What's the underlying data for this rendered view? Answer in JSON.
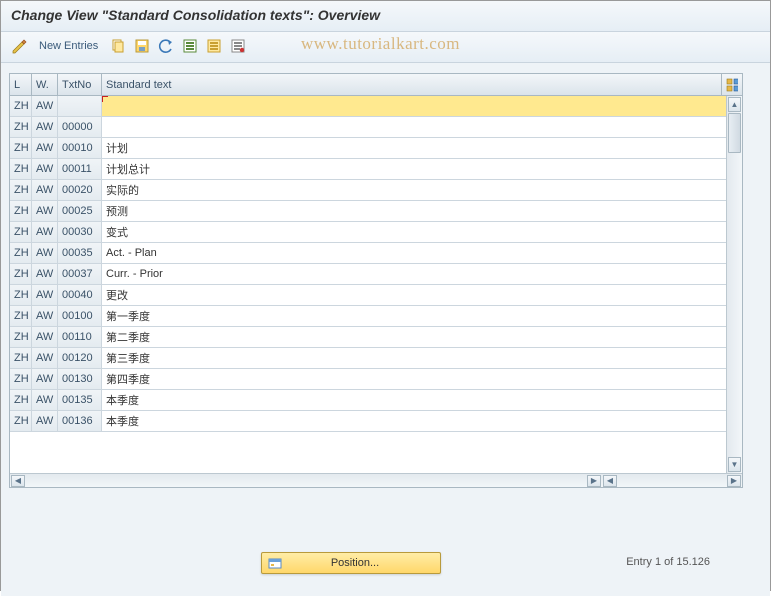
{
  "title": "Change View \"Standard Consolidation texts\": Overview",
  "toolbar": {
    "new_entries": "New Entries"
  },
  "watermark": "www.tutorialkart.com",
  "table": {
    "headers": {
      "l": "L",
      "w": "W.",
      "txtno": "TxtNo",
      "std": "Standard text"
    },
    "rows": [
      {
        "l": "ZH",
        "w": "AW",
        "txtno": "",
        "std": "",
        "active": true
      },
      {
        "l": "ZH",
        "w": "AW",
        "txtno": "00000",
        "std": ""
      },
      {
        "l": "ZH",
        "w": "AW",
        "txtno": "00010",
        "std": "计划"
      },
      {
        "l": "ZH",
        "w": "AW",
        "txtno": "00011",
        "std": "计划总计"
      },
      {
        "l": "ZH",
        "w": "AW",
        "txtno": "00020",
        "std": "实际的"
      },
      {
        "l": "ZH",
        "w": "AW",
        "txtno": "00025",
        "std": "预测"
      },
      {
        "l": "ZH",
        "w": "AW",
        "txtno": "00030",
        "std": "变式"
      },
      {
        "l": "ZH",
        "w": "AW",
        "txtno": "00035",
        "std": "Act. - Plan"
      },
      {
        "l": "ZH",
        "w": "AW",
        "txtno": "00037",
        "std": "Curr. - Prior"
      },
      {
        "l": "ZH",
        "w": "AW",
        "txtno": "00040",
        "std": "更改"
      },
      {
        "l": "ZH",
        "w": "AW",
        "txtno": "00100",
        "std": "第一季度"
      },
      {
        "l": "ZH",
        "w": "AW",
        "txtno": "00110",
        "std": "第二季度"
      },
      {
        "l": "ZH",
        "w": "AW",
        "txtno": "00120",
        "std": "第三季度"
      },
      {
        "l": "ZH",
        "w": "AW",
        "txtno": "00130",
        "std": "第四季度"
      },
      {
        "l": "ZH",
        "w": "AW",
        "txtno": "00135",
        "std": "本季度"
      },
      {
        "l": "ZH",
        "w": "AW",
        "txtno": "00136",
        "std": "本季度"
      }
    ]
  },
  "footer": {
    "position_label": "Position...",
    "entry_info": "Entry 1 of 15.126"
  }
}
